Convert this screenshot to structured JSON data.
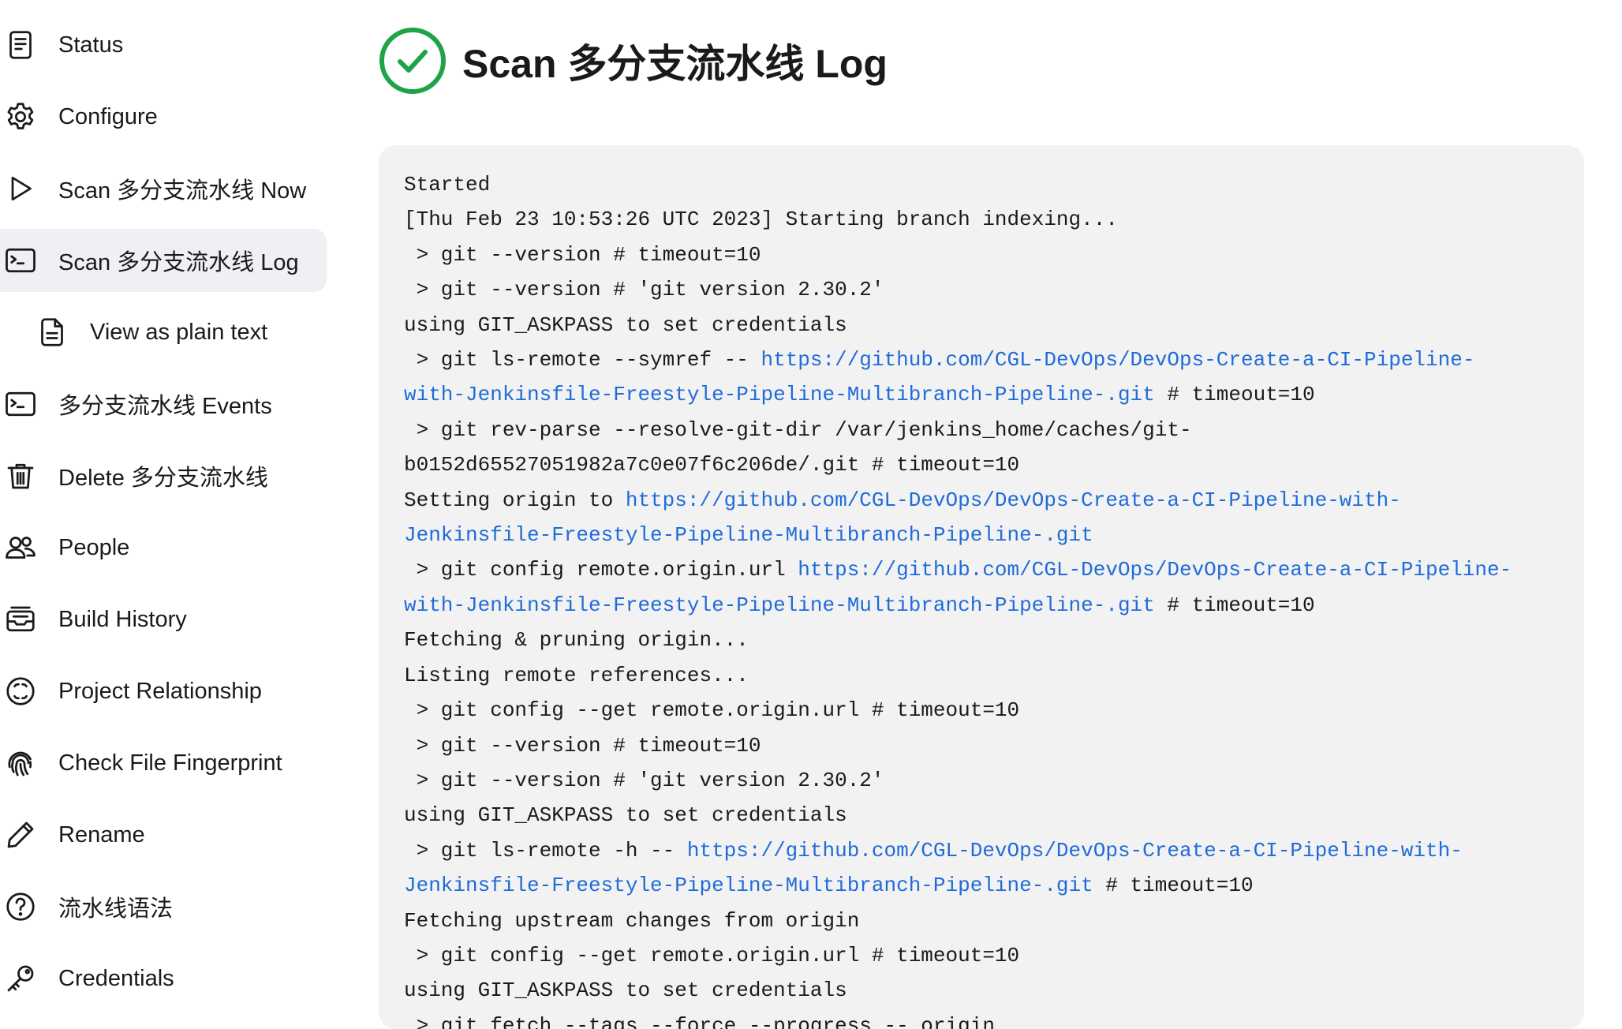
{
  "sidebar": {
    "items": [
      {
        "label": "Status",
        "icon": "document-icon",
        "active": false
      },
      {
        "label": "Configure",
        "icon": "gear-icon",
        "active": false
      },
      {
        "label": "Scan 多分支流水线 Now",
        "icon": "play-icon",
        "active": false
      },
      {
        "label": "Scan 多分支流水线 Log",
        "icon": "terminal-icon",
        "active": true
      },
      {
        "label": "View as plain text",
        "icon": "file-text-icon",
        "active": false,
        "sub": true
      },
      {
        "label": "多分支流水线 Events",
        "icon": "terminal-icon",
        "active": false
      },
      {
        "label": "Delete 多分支流水线",
        "icon": "trash-icon",
        "active": false
      },
      {
        "label": "People",
        "icon": "people-icon",
        "active": false
      },
      {
        "label": "Build History",
        "icon": "inbox-icon",
        "active": false
      },
      {
        "label": "Project Relationship",
        "icon": "relationship-icon",
        "active": false
      },
      {
        "label": "Check File Fingerprint",
        "icon": "fingerprint-icon",
        "active": false
      },
      {
        "label": "Rename",
        "icon": "pencil-icon",
        "active": false
      },
      {
        "label": "流水线语法",
        "icon": "help-circle-icon",
        "active": false
      },
      {
        "label": "Credentials",
        "icon": "key-icon",
        "active": false
      }
    ]
  },
  "page": {
    "title": "Scan 多分支流水线 Log",
    "status_icon": "success-check-icon",
    "status_color": "#1ea446"
  },
  "console": {
    "link_color": "#1f6bd8",
    "lines": [
      [
        {
          "text": "Started"
        }
      ],
      [
        {
          "text": "[Thu Feb 23 10:53:26 UTC 2023] Starting branch indexing..."
        }
      ],
      [
        {
          "text": " > git --version # timeout=10"
        }
      ],
      [
        {
          "text": " > git --version # 'git version 2.30.2'"
        }
      ],
      [
        {
          "text": "using GIT_ASKPASS to set credentials"
        }
      ],
      [
        {
          "text": " > git ls-remote --symref -- "
        },
        {
          "text": "https://github.com/CGL-DevOps/DevOps-Create-a-CI-Pipeline-",
          "link": true
        }
      ],
      [
        {
          "text": "with-Jenkinsfile-Freestyle-Pipeline-Multibranch-Pipeline-.git",
          "link": true
        },
        {
          "text": " # timeout=10"
        }
      ],
      [
        {
          "text": " > git rev-parse --resolve-git-dir /var/jenkins_home/caches/git-"
        }
      ],
      [
        {
          "text": "b0152d65527051982a7c0e07f6c206de/.git # timeout=10"
        }
      ],
      [
        {
          "text": "Setting origin to "
        },
        {
          "text": "https://github.com/CGL-DevOps/DevOps-Create-a-CI-Pipeline-with-",
          "link": true
        }
      ],
      [
        {
          "text": "Jenkinsfile-Freestyle-Pipeline-Multibranch-Pipeline-.git",
          "link": true
        }
      ],
      [
        {
          "text": " > git config remote.origin.url "
        },
        {
          "text": "https://github.com/CGL-DevOps/DevOps-Create-a-CI-Pipeline-",
          "link": true
        }
      ],
      [
        {
          "text": "with-Jenkinsfile-Freestyle-Pipeline-Multibranch-Pipeline-.git",
          "link": true
        },
        {
          "text": " # timeout=10"
        }
      ],
      [
        {
          "text": "Fetching & pruning origin..."
        }
      ],
      [
        {
          "text": "Listing remote references..."
        }
      ],
      [
        {
          "text": " > git config --get remote.origin.url # timeout=10"
        }
      ],
      [
        {
          "text": " > git --version # timeout=10"
        }
      ],
      [
        {
          "text": " > git --version # 'git version 2.30.2'"
        }
      ],
      [
        {
          "text": "using GIT_ASKPASS to set credentials"
        }
      ],
      [
        {
          "text": " > git ls-remote -h -- "
        },
        {
          "text": "https://github.com/CGL-DevOps/DevOps-Create-a-CI-Pipeline-with-",
          "link": true
        }
      ],
      [
        {
          "text": "Jenkinsfile-Freestyle-Pipeline-Multibranch-Pipeline-.git",
          "link": true
        },
        {
          "text": " # timeout=10"
        }
      ],
      [
        {
          "text": "Fetching upstream changes from origin"
        }
      ],
      [
        {
          "text": " > git config --get remote.origin.url # timeout=10"
        }
      ],
      [
        {
          "text": "using GIT_ASKPASS to set credentials"
        }
      ],
      [
        {
          "text": " > git fetch --tags --force --progress -- origin"
        }
      ]
    ]
  }
}
